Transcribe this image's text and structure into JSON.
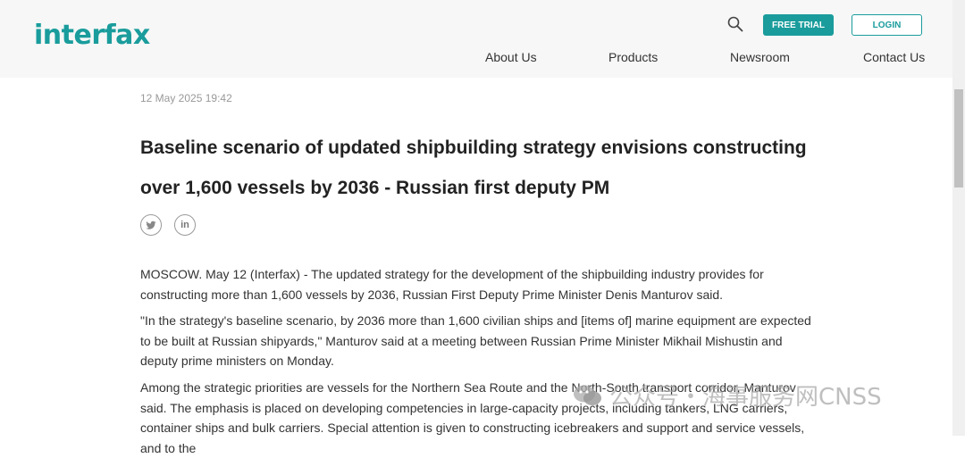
{
  "header": {
    "logo": "interfax",
    "free_trial": "FREE TRIAL",
    "login": "LOGIN",
    "nav": [
      "About Us",
      "Products",
      "Newsroom",
      "Contact Us"
    ]
  },
  "article": {
    "date": "12 May 2025 19:42",
    "title": "Baseline scenario of updated shipbuilding strategy envisions constructing over 1,600 vessels by 2036 - Russian first deputy PM",
    "paragraphs": [
      "MOSCOW. May 12 (Interfax) - The updated strategy for the development of the shipbuilding industry provides for constructing more than 1,600 vessels by 2036, Russian First Deputy Prime Minister Denis Manturov said.",
      "\"In the strategy's baseline scenario, by 2036 more than 1,600 civilian ships and [items of] marine equipment are expected to be built at Russian shipyards,\" Manturov said at a meeting between Russian Prime Minister Mikhail Mishustin and deputy prime ministers on Monday.",
      "Among the strategic priorities are vessels for the Northern Sea Route and the North-South transport corridor, Manturov said. The emphasis is placed on developing competencies in large-capacity projects, including tankers, LNG carriers, container ships and bulk carriers. Special attention is given to constructing icebreakers and support and service vessels, and to the"
    ]
  },
  "share": {
    "twitter": "twitter-icon",
    "linkedin": "in"
  },
  "watermark": "公众号・海事服务网CNSS",
  "colors": {
    "brand": "#1a9c9c"
  }
}
